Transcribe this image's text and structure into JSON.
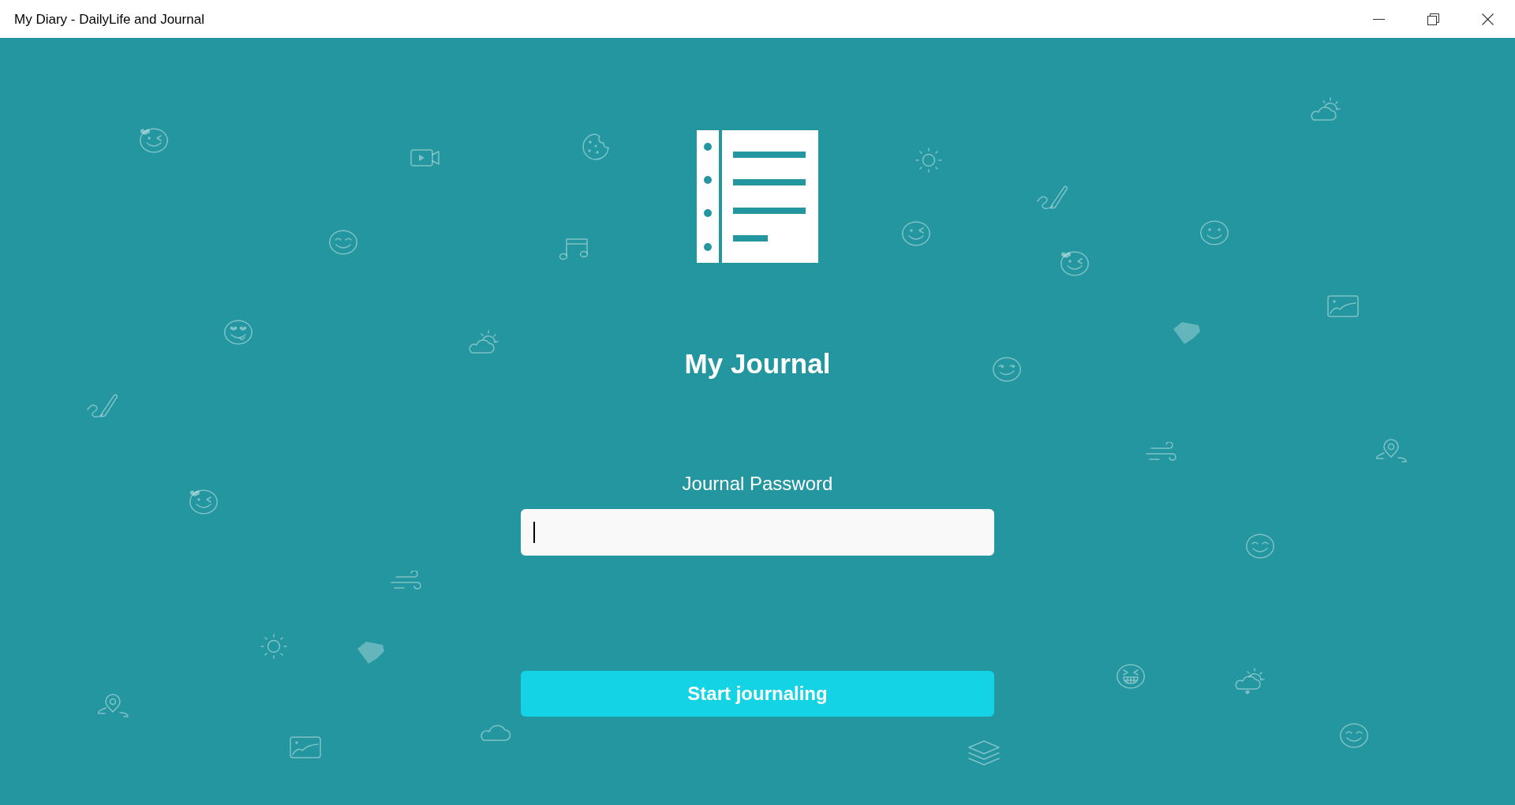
{
  "window": {
    "title": "My Diary - DailyLife and Journal"
  },
  "app": {
    "title": "My Journal"
  },
  "password_field": {
    "label": "Journal Password",
    "focused": true
  },
  "start_button": {
    "label": "Start journaling"
  }
}
